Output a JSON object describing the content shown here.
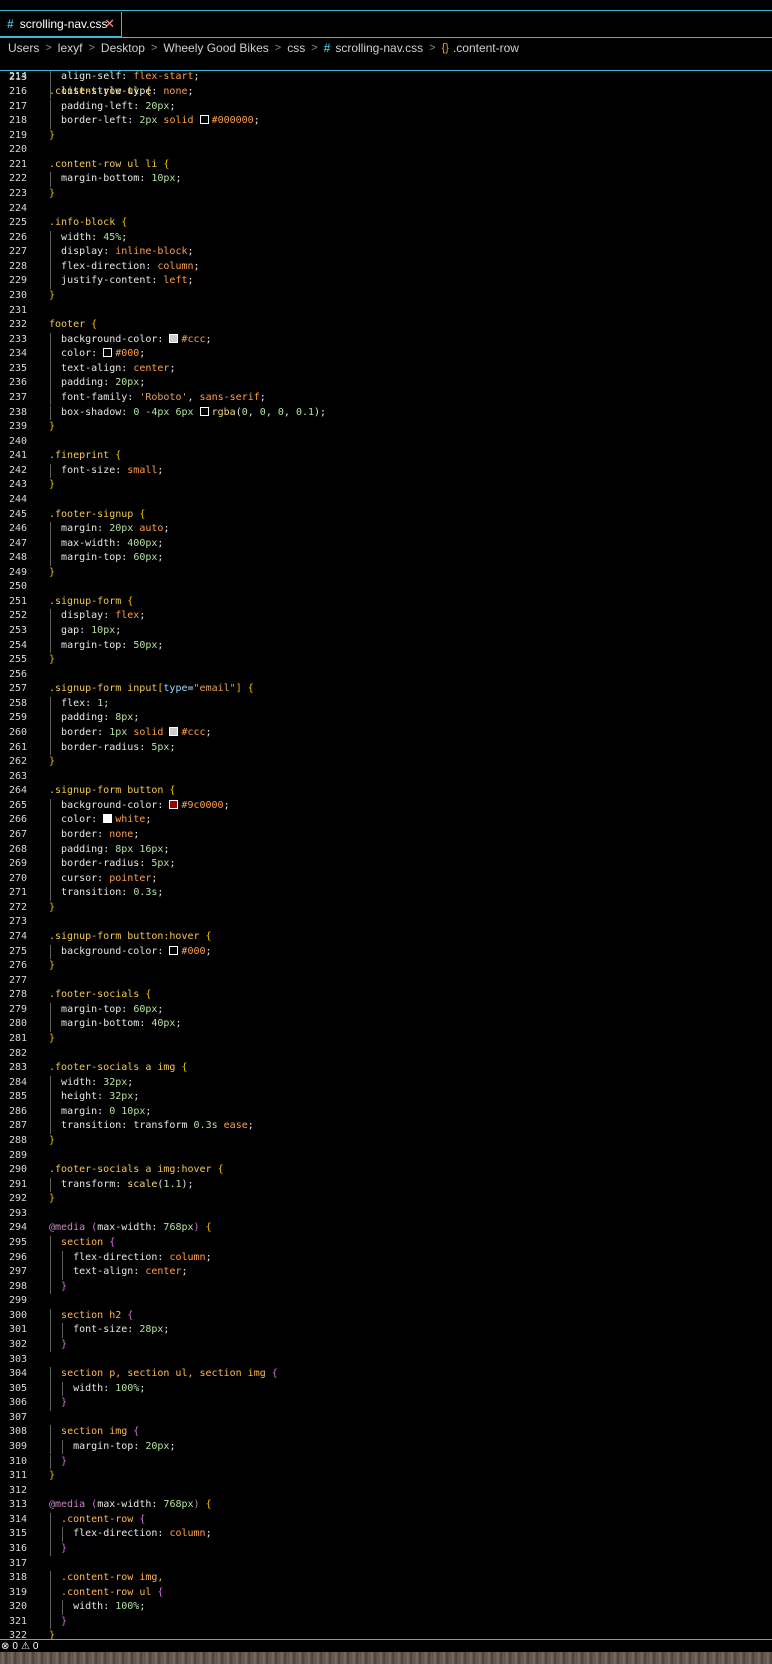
{
  "tab": {
    "label": "scrolling-nav.css",
    "close_label": "✕"
  },
  "breadcrumb": [
    "Users",
    "lexyf",
    "Desktop",
    "Wheely Good Bikes",
    "css",
    "scrolling-nav.css",
    ".content-row"
  ],
  "sticky": {
    "line_number": "213",
    "code": ".content-row ul {"
  },
  "status": {
    "errors": "0",
    "warnings": "0"
  },
  "colors": {
    "accent": "#3fb8d6",
    "selector": "#f2c94c",
    "value": "#ff9f4a",
    "number": "#b5e0a0"
  },
  "lines": [
    {
      "n": "214",
      "c": "  align-self: flex-start;",
      "k": "decl"
    },
    {
      "n": "216",
      "c": "  list-style-type: none;",
      "k": "decl"
    },
    {
      "n": "217",
      "c": "  padding-left: 20px;",
      "k": "decl"
    },
    {
      "n": "218",
      "c": "  border-left: 2px solid #000000;",
      "k": "decl"
    },
    {
      "n": "219",
      "c": "}",
      "k": "close"
    },
    {
      "n": "220",
      "c": "",
      "k": "blank"
    },
    {
      "n": "221",
      "c": ".content-row ul li {",
      "k": "sel"
    },
    {
      "n": "222",
      "c": "  margin-bottom: 10px;",
      "k": "decl"
    },
    {
      "n": "223",
      "c": "}",
      "k": "close"
    },
    {
      "n": "224",
      "c": "",
      "k": "blank"
    },
    {
      "n": "225",
      "c": ".info-block {",
      "k": "sel"
    },
    {
      "n": "226",
      "c": "  width: 45%;",
      "k": "decl"
    },
    {
      "n": "227",
      "c": "  display: inline-block;",
      "k": "decl"
    },
    {
      "n": "228",
      "c": "  flex-direction: column;",
      "k": "decl"
    },
    {
      "n": "229",
      "c": "  justify-content: left;",
      "k": "decl"
    },
    {
      "n": "230",
      "c": "}",
      "k": "close"
    },
    {
      "n": "231",
      "c": "",
      "k": "blank"
    },
    {
      "n": "232",
      "c": "footer {",
      "k": "sel"
    },
    {
      "n": "233",
      "c": "  background-color: #ccc;",
      "k": "decl"
    },
    {
      "n": "234",
      "c": "  color: #000;",
      "k": "decl"
    },
    {
      "n": "235",
      "c": "  text-align: center;",
      "k": "decl"
    },
    {
      "n": "236",
      "c": "  padding: 20px;",
      "k": "decl"
    },
    {
      "n": "237",
      "c": "  font-family: 'Roboto', sans-serif;",
      "k": "decl"
    },
    {
      "n": "238",
      "c": "  box-shadow: 0 -4px 6px rgba(0, 0, 0, 0.1);",
      "k": "decl"
    },
    {
      "n": "239",
      "c": "}",
      "k": "close"
    },
    {
      "n": "240",
      "c": "",
      "k": "blank"
    },
    {
      "n": "241",
      "c": ".fineprint {",
      "k": "sel"
    },
    {
      "n": "242",
      "c": "  font-size: small;",
      "k": "decl"
    },
    {
      "n": "243",
      "c": "}",
      "k": "close"
    },
    {
      "n": "244",
      "c": "",
      "k": "blank"
    },
    {
      "n": "245",
      "c": ".footer-signup {",
      "k": "sel"
    },
    {
      "n": "246",
      "c": "  margin: 20px auto;",
      "k": "decl"
    },
    {
      "n": "247",
      "c": "  max-width: 400px;",
      "k": "decl"
    },
    {
      "n": "248",
      "c": "  margin-top: 60px;",
      "k": "decl"
    },
    {
      "n": "249",
      "c": "}",
      "k": "close"
    },
    {
      "n": "250",
      "c": "",
      "k": "blank"
    },
    {
      "n": "251",
      "c": ".signup-form {",
      "k": "sel"
    },
    {
      "n": "252",
      "c": "  display: flex;",
      "k": "decl"
    },
    {
      "n": "253",
      "c": "  gap: 10px;",
      "k": "decl"
    },
    {
      "n": "254",
      "c": "  margin-top: 50px;",
      "k": "decl"
    },
    {
      "n": "255",
      "c": "}",
      "k": "close"
    },
    {
      "n": "256",
      "c": "",
      "k": "blank"
    },
    {
      "n": "257",
      "c": ".signup-form input[type=\"email\"] {",
      "k": "sel"
    },
    {
      "n": "258",
      "c": "  flex: 1;",
      "k": "decl"
    },
    {
      "n": "259",
      "c": "  padding: 8px;",
      "k": "decl"
    },
    {
      "n": "260",
      "c": "  border: 1px solid #ccc;",
      "k": "decl"
    },
    {
      "n": "261",
      "c": "  border-radius: 5px;",
      "k": "decl"
    },
    {
      "n": "262",
      "c": "}",
      "k": "close"
    },
    {
      "n": "263",
      "c": "",
      "k": "blank"
    },
    {
      "n": "264",
      "c": ".signup-form button {",
      "k": "sel"
    },
    {
      "n": "265",
      "c": "  background-color: #9c0000;",
      "k": "decl"
    },
    {
      "n": "266",
      "c": "  color: white;",
      "k": "decl"
    },
    {
      "n": "267",
      "c": "  border: none;",
      "k": "decl"
    },
    {
      "n": "268",
      "c": "  padding: 8px 16px;",
      "k": "decl"
    },
    {
      "n": "269",
      "c": "  border-radius: 5px;",
      "k": "decl"
    },
    {
      "n": "270",
      "c": "  cursor: pointer;",
      "k": "decl"
    },
    {
      "n": "271",
      "c": "  transition: 0.3s;",
      "k": "decl"
    },
    {
      "n": "272",
      "c": "}",
      "k": "close"
    },
    {
      "n": "273",
      "c": "",
      "k": "blank"
    },
    {
      "n": "274",
      "c": ".signup-form button:hover {",
      "k": "sel"
    },
    {
      "n": "275",
      "c": "  background-color: #000;",
      "k": "decl"
    },
    {
      "n": "276",
      "c": "}",
      "k": "close"
    },
    {
      "n": "277",
      "c": "",
      "k": "blank"
    },
    {
      "n": "278",
      "c": ".footer-socials {",
      "k": "sel"
    },
    {
      "n": "279",
      "c": "  margin-top: 60px;",
      "k": "decl"
    },
    {
      "n": "280",
      "c": "  margin-bottom: 40px;",
      "k": "decl"
    },
    {
      "n": "281",
      "c": "}",
      "k": "close"
    },
    {
      "n": "282",
      "c": "",
      "k": "blank"
    },
    {
      "n": "283",
      "c": ".footer-socials a img {",
      "k": "sel"
    },
    {
      "n": "284",
      "c": "  width: 32px;",
      "k": "decl"
    },
    {
      "n": "285",
      "c": "  height: 32px;",
      "k": "decl"
    },
    {
      "n": "286",
      "c": "  margin: 0 10px;",
      "k": "decl"
    },
    {
      "n": "287",
      "c": "  transition: transform 0.3s ease;",
      "k": "decl"
    },
    {
      "n": "288",
      "c": "}",
      "k": "close"
    },
    {
      "n": "289",
      "c": "",
      "k": "blank"
    },
    {
      "n": "290",
      "c": ".footer-socials a img:hover {",
      "k": "sel"
    },
    {
      "n": "291",
      "c": "  transform: scale(1.1);",
      "k": "decl"
    },
    {
      "n": "292",
      "c": "}",
      "k": "close"
    },
    {
      "n": "293",
      "c": "",
      "k": "blank"
    },
    {
      "n": "294",
      "c": "@media (max-width: 768px) {",
      "k": "media"
    },
    {
      "n": "295",
      "c": "  section {",
      "k": "nsel"
    },
    {
      "n": "296",
      "c": "    flex-direction: column;",
      "k": "ndecl"
    },
    {
      "n": "297",
      "c": "    text-align: center;",
      "k": "ndecl"
    },
    {
      "n": "298",
      "c": "  }",
      "k": "nclose"
    },
    {
      "n": "299",
      "c": "",
      "k": "blank"
    },
    {
      "n": "300",
      "c": "  section h2 {",
      "k": "nsel"
    },
    {
      "n": "301",
      "c": "    font-size: 28px;",
      "k": "ndecl"
    },
    {
      "n": "302",
      "c": "  }",
      "k": "nclose"
    },
    {
      "n": "303",
      "c": "",
      "k": "blank"
    },
    {
      "n": "304",
      "c": "  section p, section ul, section img {",
      "k": "nsel"
    },
    {
      "n": "305",
      "c": "    width: 100%;",
      "k": "ndecl"
    },
    {
      "n": "306",
      "c": "  }",
      "k": "nclose"
    },
    {
      "n": "307",
      "c": "",
      "k": "blank"
    },
    {
      "n": "308",
      "c": "  section img {",
      "k": "nsel"
    },
    {
      "n": "309",
      "c": "    margin-top: 20px;",
      "k": "ndecl"
    },
    {
      "n": "310",
      "c": "  }",
      "k": "nclose"
    },
    {
      "n": "311",
      "c": "}",
      "k": "close"
    },
    {
      "n": "312",
      "c": "",
      "k": "blank"
    },
    {
      "n": "313",
      "c": "@media (max-width: 768px) {",
      "k": "media"
    },
    {
      "n": "314",
      "c": "  .content-row {",
      "k": "nsel"
    },
    {
      "n": "315",
      "c": "    flex-direction: column;",
      "k": "ndecl"
    },
    {
      "n": "316",
      "c": "  }",
      "k": "nclose"
    },
    {
      "n": "317",
      "c": "",
      "k": "blank"
    },
    {
      "n": "318",
      "c": "  .content-row img,",
      "k": "nsel"
    },
    {
      "n": "319",
      "c": "  .content-row ul {",
      "k": "nsel"
    },
    {
      "n": "320",
      "c": "    width: 100%;",
      "k": "ndecl"
    },
    {
      "n": "321",
      "c": "  }",
      "k": "nclose"
    },
    {
      "n": "322",
      "c": "}",
      "k": "close"
    }
  ]
}
